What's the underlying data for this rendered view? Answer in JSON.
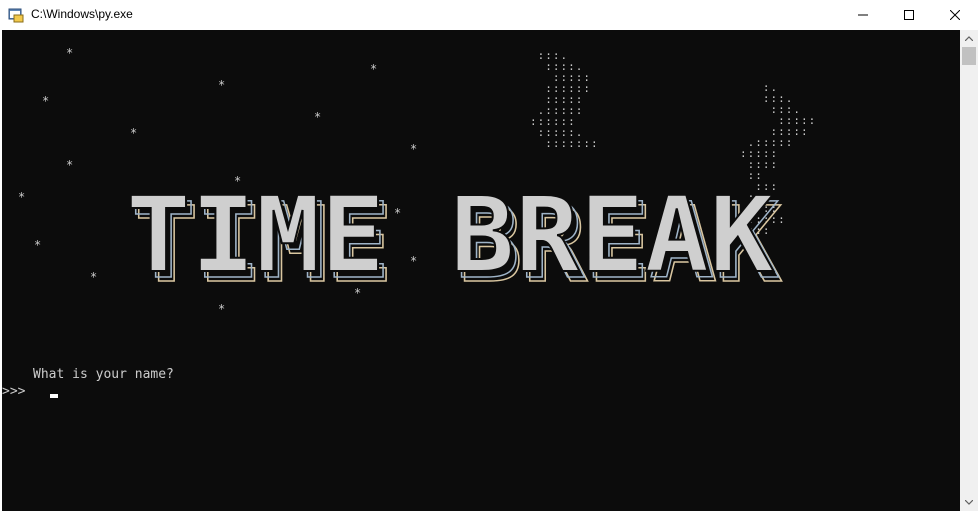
{
  "window": {
    "title": "C:\\Windows\\py.exe",
    "icon": "python-console-icon",
    "controls": [
      "minimize-icon",
      "maximize-icon",
      "close-icon"
    ]
  },
  "console": {
    "background": "#0c0c0c",
    "foreground": "#cccccc",
    "logo_text": "TIME BREAK",
    "star_glyph": "*",
    "question": "What is your name?",
    "prompt_marker": ">>>"
  }
}
